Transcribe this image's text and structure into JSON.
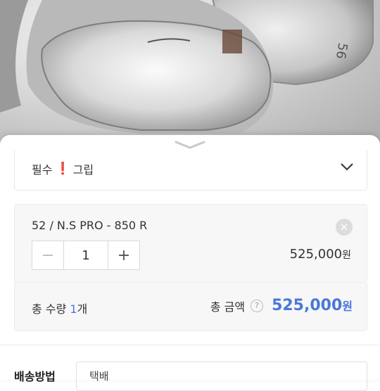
{
  "photo": {
    "engraving_number": "56"
  },
  "option": {
    "required_label": "필수",
    "name": "그립"
  },
  "item": {
    "name": "52 / N.S PRO - 850 R",
    "quantity": "1",
    "price": "525,000",
    "currency": "원"
  },
  "total": {
    "qty_prefix": "총 수량 ",
    "qty_value": "1",
    "qty_suffix": "개",
    "label": "총 금액",
    "help": "?",
    "price": "525,000",
    "currency": "원"
  },
  "shipping": {
    "label": "배송방법",
    "value": "택배"
  },
  "colors": {
    "accent": "#4a78d9",
    "required": "#e02020"
  }
}
